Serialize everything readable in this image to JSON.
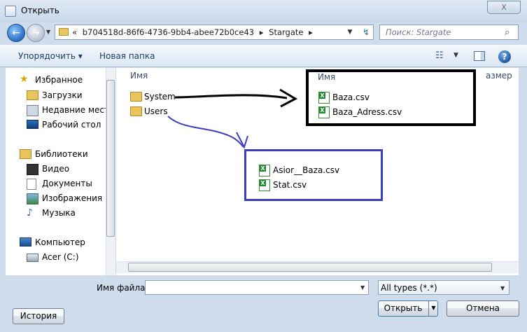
{
  "window": {
    "title": "Открыть",
    "close_glyph": "X"
  },
  "nav": {
    "breadcrumb_prefix": "«",
    "path_segment_1": "b704518d-86f6-4736-9bb4-abee72b0ce43",
    "separator": "▸",
    "path_segment_2": "Stargate",
    "search_placeholder": "Поиск: Stargate"
  },
  "toolbar": {
    "organize_label": "Упорядочить ▾",
    "new_folder_label": "Новая папка",
    "help_label": "?"
  },
  "sidebar": {
    "items": [
      {
        "label": "Избранное",
        "icon": "star-icon"
      },
      {
        "label": "Загрузки",
        "icon": "downloads-folder-icon"
      },
      {
        "label": "Недавние места",
        "icon": "recent-places-icon"
      },
      {
        "label": "Рабочий стол",
        "icon": "desktop-icon"
      },
      {
        "label": "Библиотеки",
        "icon": "libraries-icon"
      },
      {
        "label": "Видео",
        "icon": "video-icon"
      },
      {
        "label": "Документы",
        "icon": "documents-icon"
      },
      {
        "label": "Изображения",
        "icon": "pictures-icon"
      },
      {
        "label": "Музыка",
        "icon": "music-icon"
      },
      {
        "label": "Компьютер",
        "icon": "computer-icon"
      },
      {
        "label": "Acer (C:)",
        "icon": "drive-icon"
      }
    ]
  },
  "file_list": {
    "column_name": "Имя",
    "column_size": "азмер",
    "folders": [
      {
        "name": "System"
      },
      {
        "name": "Users"
      }
    ]
  },
  "annotations": {
    "system_box_header": "Имя",
    "system_files": [
      {
        "name": "Baza.csv"
      },
      {
        "name": "Baza_Adress.csv"
      }
    ],
    "users_files": [
      {
        "name": "Asior__Baza.csv"
      },
      {
        "name": "Stat.csv"
      }
    ],
    "colors": {
      "system_arrow": "#000000",
      "users_arrow": "#3d3dbf"
    }
  },
  "bottom": {
    "filename_label": "Имя файла:",
    "filename_value": "",
    "filetype_value": "All types (*.*)",
    "open_label": "Открыть",
    "cancel_label": "Отмена",
    "history_label": "История"
  }
}
